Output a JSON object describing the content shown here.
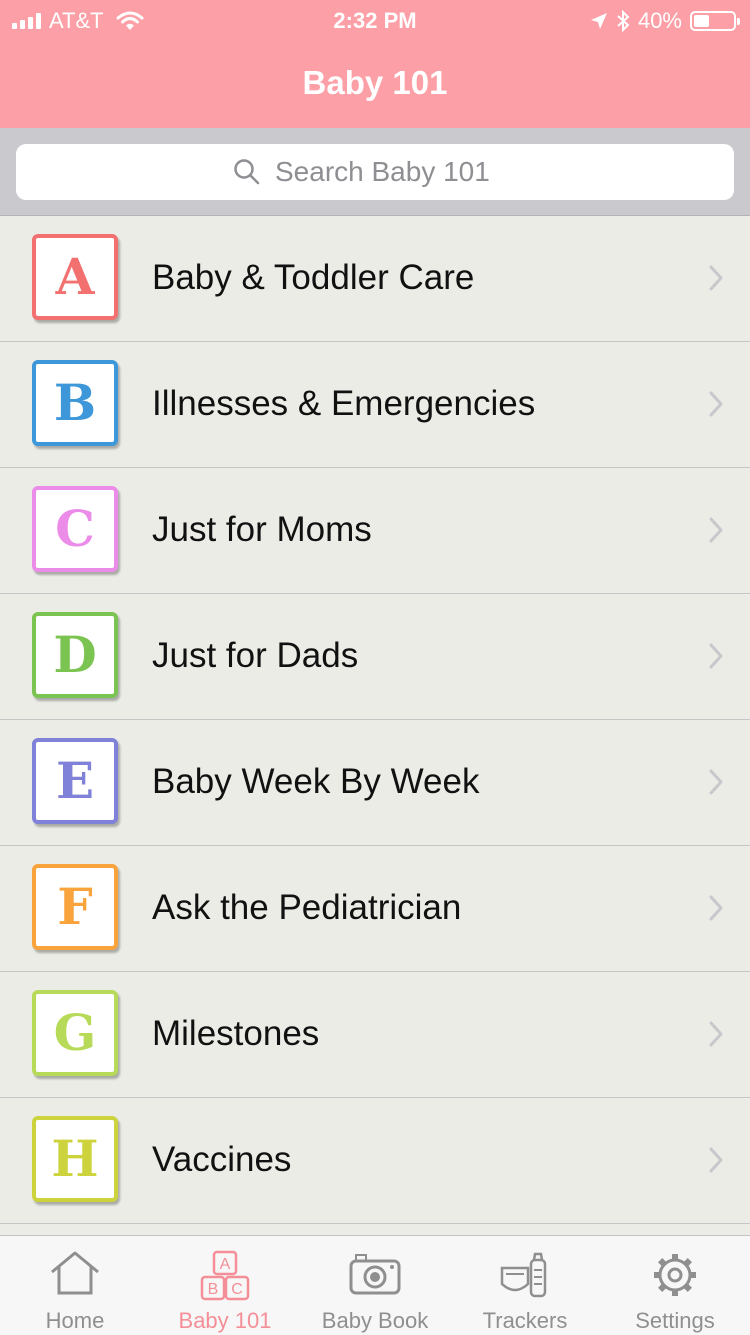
{
  "status_bar": {
    "carrier": "AT&T",
    "time": "2:32 PM",
    "battery": "40%",
    "battery_level": 0.4
  },
  "nav": {
    "title": "Baby 101"
  },
  "search": {
    "placeholder": "Search Baby 101"
  },
  "items": [
    {
      "letter": "A",
      "label": "Baby & Toddler Care",
      "color": "#f2706f"
    },
    {
      "letter": "B",
      "label": "Illnesses & Emergencies",
      "color": "#3d97d9"
    },
    {
      "letter": "C",
      "label": "Just for Moms",
      "color": "#eb8ce8"
    },
    {
      "letter": "D",
      "label": "Just for Dads",
      "color": "#7cc452"
    },
    {
      "letter": "E",
      "label": "Baby Week By Week",
      "color": "#7f82d8"
    },
    {
      "letter": "F",
      "label": "Ask the Pediatrician",
      "color": "#f8a33b"
    },
    {
      "letter": "G",
      "label": "Milestones",
      "color": "#b7da58"
    },
    {
      "letter": "H",
      "label": "Vaccines",
      "color": "#cdd33c"
    }
  ],
  "tabs": [
    {
      "label": "Home",
      "icon": "home-icon"
    },
    {
      "label": "Baby 101",
      "icon": "abc-blocks-icon",
      "active": true
    },
    {
      "label": "Baby Book",
      "icon": "camera-icon"
    },
    {
      "label": "Trackers",
      "icon": "diaper-bottle-icon"
    },
    {
      "label": "Settings",
      "icon": "gear-icon"
    }
  ],
  "colors": {
    "header": "#fc9fa6",
    "active_tab": "#f48f98",
    "inactive_tab": "#8f8f8f",
    "list_background": "#ecece7"
  }
}
